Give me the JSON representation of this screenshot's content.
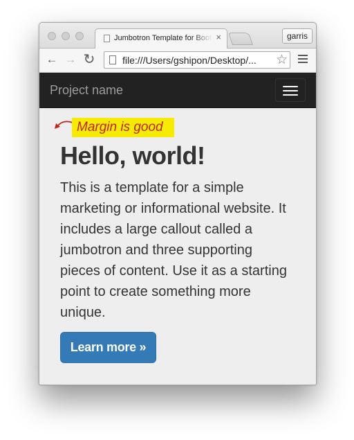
{
  "browser": {
    "tab_title": "Jumbotron Template for Bootstrap",
    "tab_close": "×",
    "profile_name": "garris",
    "back_icon": "←",
    "forward_icon": "→",
    "reload_icon": "↻",
    "address": "file:///Users/gshipon/Desktop/...",
    "bookmark_icon": "☆"
  },
  "navbar": {
    "brand": "Project name",
    "background": "#222222",
    "brand_color": "#9d9d9d"
  },
  "annotation": {
    "text": "Margin is good",
    "background": "#f6ec00",
    "text_color": "#c0221c"
  },
  "jumbotron": {
    "heading": "Hello, world!",
    "lead_lines": [
      "This is a template for a simple",
      "marketing or informational website. It",
      "includes a large callout called a",
      "jumbotron and three supporting",
      "pieces of content. Use it as a starting",
      "point to create something more",
      "unique."
    ],
    "button_label": "Learn more »",
    "button_color": "#337ab7"
  }
}
